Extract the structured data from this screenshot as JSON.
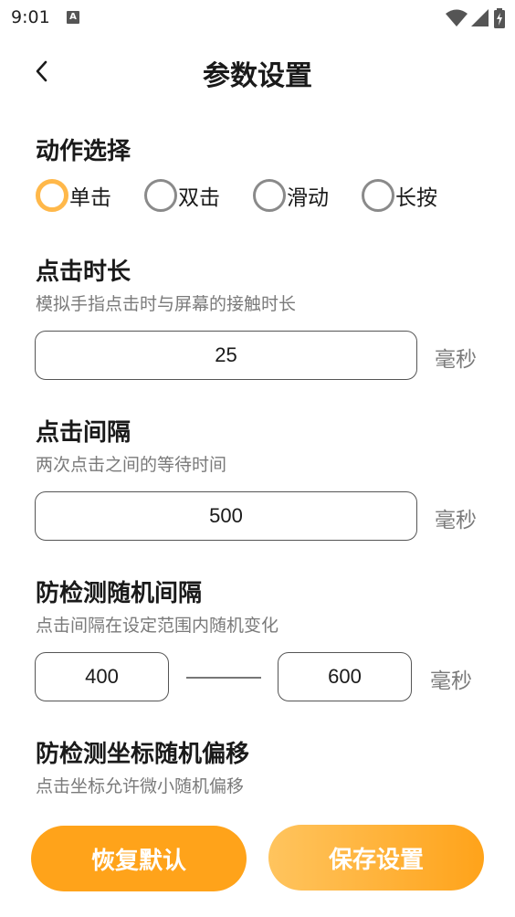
{
  "status_bar": {
    "time": "9:01",
    "icon_a": "A",
    "icons": [
      "wifi-icon",
      "signal-icon",
      "battery-charging-icon"
    ]
  },
  "header": {
    "title": "参数设置",
    "back_icon": "chevron-left-icon"
  },
  "action": {
    "title": "动作选择",
    "options": [
      "单击",
      "双击",
      "滑动",
      "长按"
    ],
    "selected": "单击"
  },
  "click_duration": {
    "title": "点击时长",
    "description": "模拟手指点击时与屏幕的接触时长",
    "value": "25",
    "unit": "毫秒"
  },
  "click_interval": {
    "title": "点击间隔",
    "description": "两次点击之间的等待时间",
    "value": "500",
    "unit": "毫秒"
  },
  "random_interval": {
    "title": "防检测随机间隔",
    "description": "点击间隔在设定范围内随机变化",
    "min": "400",
    "max": "600",
    "unit": "毫秒"
  },
  "random_offset": {
    "title": "防检测坐标随机偏移",
    "description": "点击坐标允许微小随机偏移"
  },
  "buttons": {
    "reset": "恢复默认",
    "save": "保存设置"
  },
  "colors": {
    "accent": "#FFA31A",
    "accent_light": "#FFB84A",
    "text_secondary": "#7a7a7a"
  }
}
